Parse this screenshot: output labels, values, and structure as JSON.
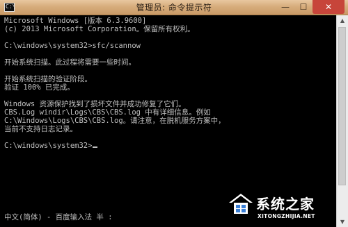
{
  "window": {
    "title": "管理员: 命令提示符",
    "icon": "cmd-icon",
    "controls": {
      "minimize": "—",
      "maximize": "☐",
      "close": "✕"
    }
  },
  "console": {
    "lines": [
      "Microsoft Windows [版本 6.3.9600]",
      "(c) 2013 Microsoft Corporation。保留所有权利。",
      "",
      "C:\\windows\\system32>sfc/scannow",
      "",
      "开始系统扫描。此过程将需要一些时间。",
      "",
      "开始系统扫描的验证阶段。",
      "验证 100% 已完成。",
      "",
      "Windows 资源保护找到了损坏文件并成功修复了它们。",
      "CBS.Log windir\\Logs\\CBS\\CBS.log 中有详细信息。例如",
      "C:\\Windows\\Logs\\CBS\\CBS.log。请注意，在脱机服务方案中，",
      "当前不支持日志记录。",
      "",
      "C:\\windows\\system32>"
    ],
    "ime_status": "中文(简体) - 百度输入法 半 :"
  },
  "scrollbar": {
    "up_arrow": "▲",
    "down_arrow": "▼"
  },
  "watermark": {
    "text": "系统之家",
    "url": "XITONGZHIJIA.NET"
  },
  "colors": {
    "console_bg": "#000000",
    "console_text": "#c0c0c0",
    "titlebar": "#d7ad7c",
    "close_button": "#c7453a"
  }
}
